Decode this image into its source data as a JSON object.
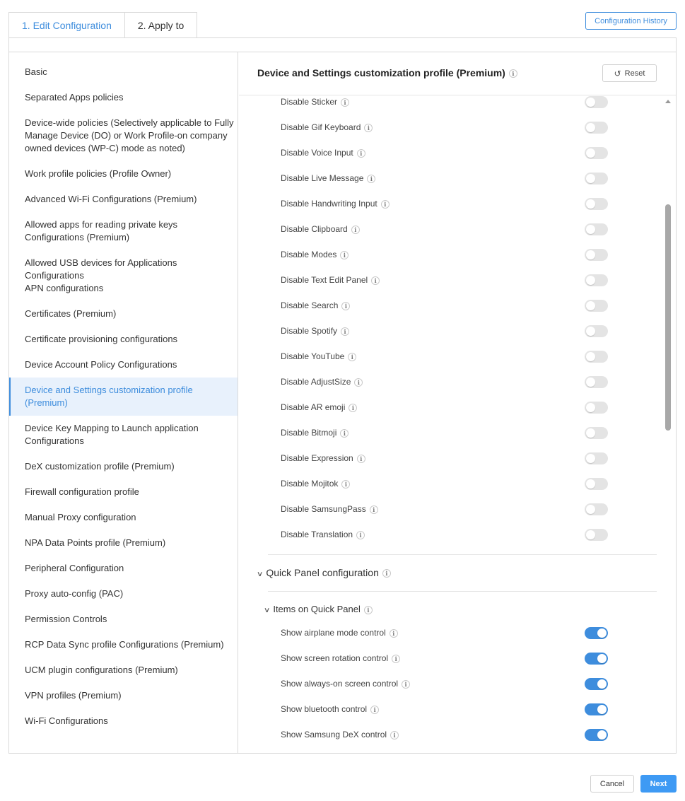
{
  "tabs": [
    {
      "label": "1. Edit Configuration",
      "active": true
    },
    {
      "label": "2. Apply to",
      "active": false
    }
  ],
  "config_history_label": "Configuration History",
  "sidebar": {
    "items": [
      "Basic",
      "Separated Apps policies",
      "Device-wide policies (Selectively applicable to Fully Manage Device (DO) or Work Profile-on company owned devices (WP-C) mode as noted)",
      "Work profile policies (Profile Owner)",
      "Advanced Wi-Fi Configurations (Premium)",
      "Allowed apps for reading private keys Configurations (Premium)",
      "Allowed USB devices for Applications Configurations",
      "APN configurations",
      "Certificates (Premium)",
      "Certificate provisioning configurations",
      "Device Account Policy Configurations",
      "Device and Settings customization profile (Premium)",
      "Device Key Mapping to Launch application Configurations",
      "DeX customization profile (Premium)",
      "Firewall configuration profile",
      "Manual Proxy configuration",
      "NPA Data Points profile (Premium)",
      "Peripheral Configuration",
      "Proxy auto-config (PAC)",
      "Permission Controls",
      "RCP Data Sync profile Configurations (Premium)",
      "UCM plugin configurations (Premium)",
      "VPN profiles (Premium)",
      "Wi-Fi Configurations"
    ],
    "active_index": 11
  },
  "content": {
    "title": "Device and Settings customization profile (Premium)",
    "reset_label": "Reset",
    "info_glyph": "i",
    "disable_rows": [
      {
        "label": "Disable Sticker",
        "enabled": false
      },
      {
        "label": "Disable Gif Keyboard",
        "enabled": false
      },
      {
        "label": "Disable Voice Input",
        "enabled": false
      },
      {
        "label": "Disable Live Message",
        "enabled": false
      },
      {
        "label": "Disable Handwriting Input",
        "enabled": false
      },
      {
        "label": "Disable Clipboard",
        "enabled": false
      },
      {
        "label": "Disable Modes",
        "enabled": false
      },
      {
        "label": "Disable Text Edit Panel",
        "enabled": false
      },
      {
        "label": "Disable Search",
        "enabled": false
      },
      {
        "label": "Disable Spotify",
        "enabled": false
      },
      {
        "label": "Disable YouTube",
        "enabled": false
      },
      {
        "label": "Disable AdjustSize",
        "enabled": false
      },
      {
        "label": "Disable AR emoji",
        "enabled": false
      },
      {
        "label": "Disable Bitmoji",
        "enabled": false
      },
      {
        "label": "Disable Expression",
        "enabled": false
      },
      {
        "label": "Disable Mojitok",
        "enabled": false
      },
      {
        "label": "Disable SamsungPass",
        "enabled": false
      },
      {
        "label": "Disable Translation",
        "enabled": false
      }
    ],
    "quick_panel_section": "Quick Panel configuration",
    "items_on_quick_panel": "Items on Quick Panel",
    "quick_rows": [
      {
        "label": "Show airplane mode control",
        "enabled": true
      },
      {
        "label": "Show screen rotation control",
        "enabled": true
      },
      {
        "label": "Show always-on screen control",
        "enabled": true
      },
      {
        "label": "Show bluetooth control",
        "enabled": true
      },
      {
        "label": "Show Samsung DeX control",
        "enabled": true
      }
    ]
  },
  "footer": {
    "cancel_label": "Cancel",
    "next_label": "Next"
  },
  "colors": {
    "accent": "#3e8ddd",
    "toggle_off": "#e4e4e4",
    "active_bg": "#e8f1fc",
    "next_bg": "#3e9af4"
  }
}
